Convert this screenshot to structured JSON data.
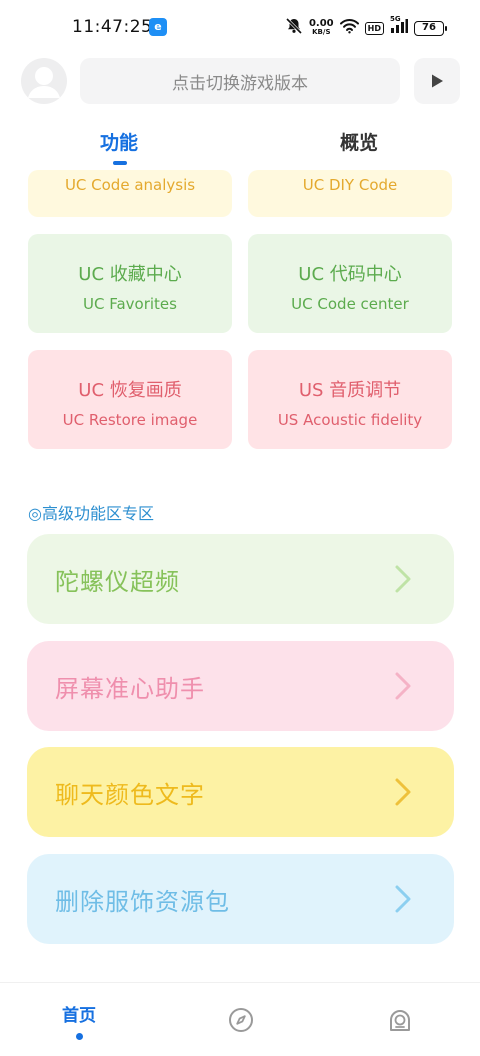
{
  "status_bar": {
    "time": "11:47:25",
    "app_icon_letter": "e",
    "net_speed_value": "0.00",
    "net_speed_unit": "KB/S",
    "hd_label": "HD",
    "signal_label": "5G",
    "battery": "76"
  },
  "header": {
    "search_placeholder": "点击切换游戏版本"
  },
  "tabs": [
    {
      "label": "功能",
      "active": true
    },
    {
      "label": "概览",
      "active": false
    }
  ],
  "feature_grid": [
    {
      "title": "",
      "subtitle": "UC Code analysis",
      "color": "yellow"
    },
    {
      "title": "",
      "subtitle": "UC DIY Code",
      "color": "yellow"
    },
    {
      "title": "UC 收藏中心",
      "subtitle": "UC Favorites",
      "color": "green"
    },
    {
      "title": "UC 代码中心",
      "subtitle": "UC Code center",
      "color": "green"
    },
    {
      "title": "UC 恢复画质",
      "subtitle": "UC Restore image",
      "color": "pink"
    },
    {
      "title": "US 音质调节",
      "subtitle": "US Acoustic fidelity",
      "color": "pink"
    }
  ],
  "advanced_section": {
    "label": "◎高级功能区专区",
    "items": [
      {
        "label": "陀螺仪超频",
        "bg": "#edf7e6",
        "fg": "#86c25a"
      },
      {
        "label": "屏幕准心助手",
        "bg": "#fde1ea",
        "fg": "#ef8fad"
      },
      {
        "label": "聊天颜色文字",
        "bg": "#fdf2a4",
        "fg": "#eeba1d"
      },
      {
        "label": "删除服饰资源包",
        "bg": "#e0f3fc",
        "fg": "#6fbde6"
      }
    ]
  },
  "bottom_nav": {
    "home_label": "首页",
    "compass_icon": "compass-icon",
    "profile_icon": "profile-icon"
  },
  "colors": {
    "accent": "#1670e0",
    "section_label": "#2d8fd0"
  }
}
